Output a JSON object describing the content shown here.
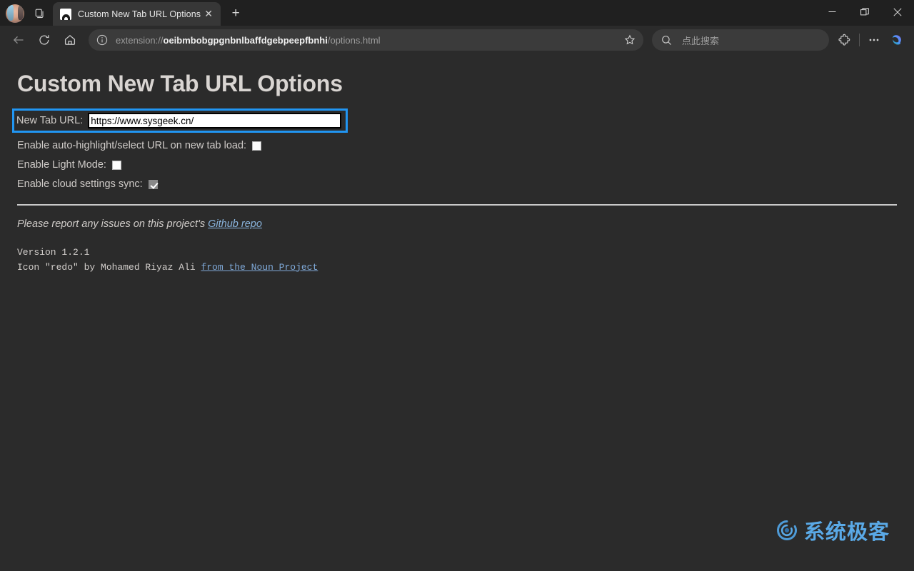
{
  "browser": {
    "window_controls": {
      "minimize": "minimize-button",
      "restore": "restore-button",
      "close": "close-button"
    },
    "tab": {
      "title": "Custom New Tab URL Options",
      "close_label": "✕",
      "favicon": "extension-arch-icon"
    },
    "new_tab_label": "+",
    "tab_search_icon": "tab-search-icon",
    "nav": {
      "back_icon": "back-arrow-icon",
      "refresh_icon": "refresh-icon",
      "home_icon": "home-icon"
    },
    "address": {
      "info_icon": "info-circle-icon",
      "scheme": "extension://",
      "host": "oeibmbobgpgnbnlbaffdgebpeepfbnhi",
      "path": "/options.html",
      "full_url": "extension://oeibmbobgpgnbnlbaffdgebpeepfbnhi/options.html",
      "star_icon": "favorite-star-icon"
    },
    "search": {
      "placeholder": "点此搜索",
      "icon": "search-icon"
    },
    "toolbar_right": {
      "extensions_icon": "extensions-puzzle-icon",
      "more_icon": "more-options-icon",
      "copilot_icon": "copilot-icon"
    },
    "avatar": "profile-avatar"
  },
  "page": {
    "title": "Custom New Tab URL Options",
    "url_field": {
      "label": "New Tab URL:",
      "value": "https://www.sysgeek.cn/",
      "placeholder": "",
      "focused": true,
      "focus_color": "#2196f3"
    },
    "options": [
      {
        "label": "Enable auto-highlight/select URL on new tab load:",
        "checked": false,
        "name": "auto-highlight-checkbox"
      },
      {
        "label": "Enable Light Mode:",
        "checked": false,
        "name": "light-mode-checkbox"
      },
      {
        "label": "Enable cloud settings sync:",
        "checked": true,
        "name": "cloud-sync-checkbox"
      }
    ],
    "footer": {
      "report_text": "Please report any issues on this project's",
      "report_link": "Github repo",
      "version": "Version 1.2.1",
      "credit_prefix": "Icon \"redo\" by Mohamed Riyaz Ali",
      "credit_link": "from the Noun Project"
    },
    "watermark": {
      "text": "系统极客",
      "color": "#5aa9e6",
      "logo": "sysgeek-swirl-logo"
    }
  }
}
